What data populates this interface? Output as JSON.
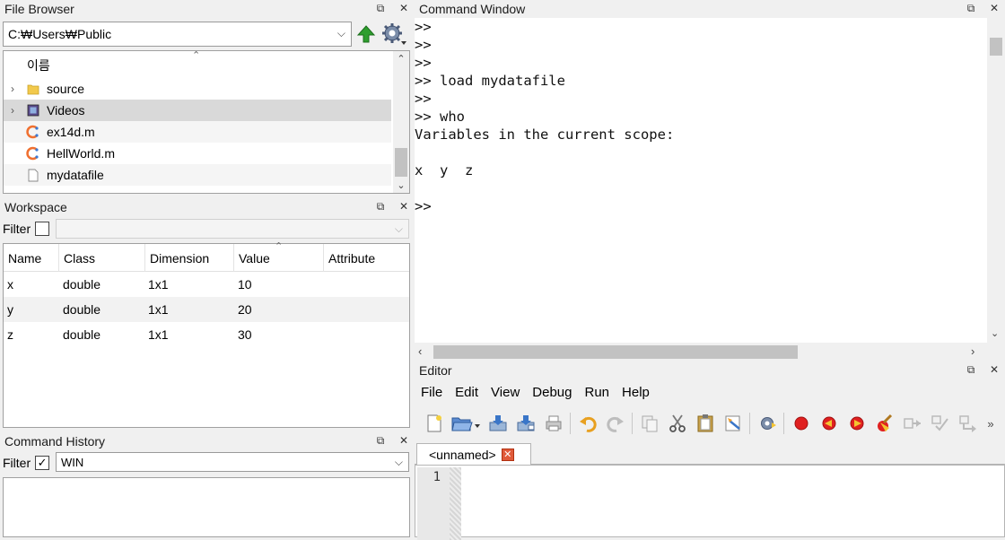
{
  "file_browser": {
    "title": "File Browser",
    "path": "C:₩Users₩Public",
    "column_header": "이름",
    "items": [
      {
        "label": "source",
        "type": "folder",
        "expandable": true
      },
      {
        "label": "Videos",
        "type": "video-folder",
        "expandable": true
      },
      {
        "label": "ex14d.m",
        "type": "octave-file",
        "expandable": false
      },
      {
        "label": "HellWorld.m",
        "type": "octave-file",
        "expandable": false
      },
      {
        "label": "mydatafile",
        "type": "file",
        "expandable": false
      }
    ]
  },
  "workspace": {
    "title": "Workspace",
    "filter_label": "Filter",
    "filter_checked": false,
    "columns": [
      "Name",
      "Class",
      "Dimension",
      "Value",
      "Attribute"
    ],
    "rows": [
      [
        "x",
        "double",
        "1x1",
        "10",
        ""
      ],
      [
        "y",
        "double",
        "1x1",
        "20",
        ""
      ],
      [
        "z",
        "double",
        "1x1",
        "30",
        ""
      ]
    ]
  },
  "command_history": {
    "title": "Command History",
    "filter_label": "Filter",
    "filter_checked": true,
    "filter_value": "WIN"
  },
  "command_window": {
    "title": "Command Window",
    "text": ">>\n>>\n>>\n>> load mydatafile\n>>\n>> who\nVariables in the current scope:\n\nx  y  z\n\n>>"
  },
  "editor": {
    "title": "Editor",
    "menu": [
      "File",
      "Edit",
      "View",
      "Debug",
      "Run",
      "Help"
    ],
    "tab_label": "<unnamed>",
    "line_number": "1"
  },
  "colors": {
    "accent_red": "#e02020",
    "folder_yellow": "#f2c94c",
    "up_green": "#2e9e2e"
  }
}
